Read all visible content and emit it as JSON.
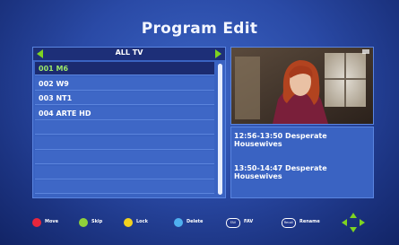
{
  "title": "Program Edit",
  "channel_list": {
    "group": "ALL TV",
    "channels": [
      {
        "label": "001 M6",
        "selected": true
      },
      {
        "label": "002 W9",
        "selected": false
      },
      {
        "label": "003 NT1",
        "selected": false
      },
      {
        "label": "004 ARTE HD",
        "selected": false
      },
      {
        "label": "",
        "selected": false
      },
      {
        "label": "",
        "selected": false
      },
      {
        "label": "",
        "selected": false
      },
      {
        "label": "",
        "selected": false
      },
      {
        "label": "",
        "selected": false
      },
      {
        "label": "",
        "selected": false
      }
    ]
  },
  "epg": [
    {
      "time": "12:56-13:50",
      "program": "Desperate Housewives"
    },
    {
      "time": "13:50-14:47",
      "program": "Desperate Housewives"
    }
  ],
  "footer": {
    "move": {
      "label": "Move",
      "color": "#e8263c"
    },
    "skip": {
      "label": "Skip",
      "color": "#8fd13a"
    },
    "lock": {
      "label": "Lock",
      "color": "#f2d21f"
    },
    "delete": {
      "label": "Delete",
      "color": "#4fb0f0"
    },
    "fav": {
      "label": "FAV",
      "key": "FAV"
    },
    "rename": {
      "label": "Rename",
      "key": "Recall"
    }
  },
  "colors": {
    "accent_green": "#7ed321",
    "selected_text": "#9be86a"
  }
}
